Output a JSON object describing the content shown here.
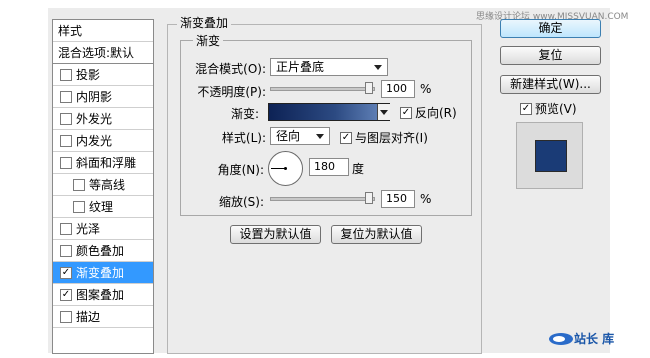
{
  "watermark": "思缘设计论坛 www.MISSVUAN.COM",
  "style_list": {
    "header": "样式",
    "blend_options": "混合选项:默认",
    "items": [
      {
        "label": "投影",
        "checked": false,
        "indent": false,
        "selected": false
      },
      {
        "label": "内阴影",
        "checked": false,
        "indent": false,
        "selected": false
      },
      {
        "label": "外发光",
        "checked": false,
        "indent": false,
        "selected": false
      },
      {
        "label": "内发光",
        "checked": false,
        "indent": false,
        "selected": false
      },
      {
        "label": "斜面和浮雕",
        "checked": false,
        "indent": false,
        "selected": false
      },
      {
        "label": "等高线",
        "checked": false,
        "indent": true,
        "selected": false
      },
      {
        "label": "纹理",
        "checked": false,
        "indent": true,
        "selected": false
      },
      {
        "label": "光泽",
        "checked": false,
        "indent": false,
        "selected": false
      },
      {
        "label": "颜色叠加",
        "checked": false,
        "indent": false,
        "selected": false
      },
      {
        "label": "渐变叠加",
        "checked": true,
        "indent": false,
        "selected": true
      },
      {
        "label": "图案叠加",
        "checked": true,
        "indent": false,
        "selected": false
      },
      {
        "label": "描边",
        "checked": false,
        "indent": false,
        "selected": false
      }
    ]
  },
  "panel": {
    "title": "渐变叠加",
    "group_title": "渐变",
    "blend_mode_label": "混合模式(O):",
    "blend_mode_value": "正片叠底",
    "opacity_label": "不透明度(P):",
    "opacity_value": "100",
    "opacity_unit": "%",
    "opacity_level": 1.0,
    "gradient_label": "渐变:",
    "reverse_label": "反向(R)",
    "reverse_checked": true,
    "style_label": "样式(L):",
    "style_value": "径向",
    "align_label": "与图层对齐(I)",
    "align_checked": true,
    "angle_label": "角度(N):",
    "angle_value": "180",
    "angle_unit": "度",
    "scale_label": "缩放(S):",
    "scale_value": "150",
    "scale_unit": "%",
    "scale_level": 1.0,
    "set_default_label": "设置为默认值",
    "reset_default_label": "复位为默认值"
  },
  "side": {
    "ok_label": "确定",
    "reset_label": "复位",
    "new_style_label": "新建样式(W)...",
    "preview_label": "预览(V)",
    "preview_checked": true,
    "swatch_color": "#1a3b76"
  },
  "logo_text": "站长 库",
  "check_mark": "✓"
}
